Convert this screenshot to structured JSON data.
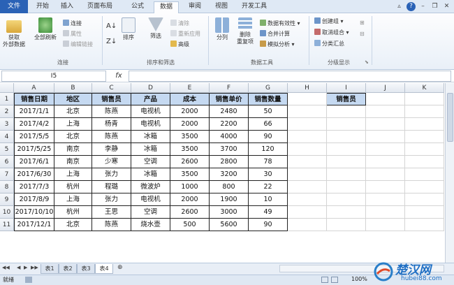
{
  "tabs": [
    "文件",
    "开始",
    "插入",
    "页面布局",
    "公式",
    "数据",
    "审阅",
    "视图",
    "开发工具"
  ],
  "active_tab": "数据",
  "ribbon": {
    "get_external": "获取\n外部数据",
    "refresh_all": "全部刷新",
    "connections": "连接",
    "properties": "属性",
    "edit_links": "编辑链接",
    "group_connections": "连接",
    "sort": "排序",
    "filter": "筛选",
    "clear": "清除",
    "reapply": "重新应用",
    "advanced": "高级",
    "group_sort_filter": "排序和筛选",
    "text_to_columns": "分列",
    "remove_duplicates": "删除\n重复项",
    "data_validation": "数据有效性",
    "consolidate": "合并计算",
    "what_if": "模拟分析",
    "group_data_tools": "数据工具",
    "group_btn": "创建组",
    "ungroup_btn": "取消组合",
    "subtotal": "分类汇总",
    "group_outline": "分级显示"
  },
  "formula_bar": {
    "name_box": "I5",
    "fx": "fx",
    "content": ""
  },
  "columns": [
    "A",
    "B",
    "C",
    "D",
    "E",
    "F",
    "G",
    "H",
    "I",
    "J",
    "K"
  ],
  "rows": [
    "1",
    "2",
    "3",
    "4",
    "5",
    "6",
    "7",
    "8",
    "9",
    "10",
    "11"
  ],
  "table_headers": [
    "销售日期",
    "地区",
    "销售员",
    "产品",
    "成本",
    "销售单价",
    "销售数量"
  ],
  "table_rows": [
    [
      "2017/1/1",
      "北京",
      "陈燕",
      "电视机",
      "2000",
      "2480",
      "50"
    ],
    [
      "2017/4/2",
      "上海",
      "杨青",
      "电视机",
      "2000",
      "2200",
      "66"
    ],
    [
      "2017/5/5",
      "北京",
      "陈燕",
      "冰箱",
      "3500",
      "4000",
      "90"
    ],
    [
      "2017/5/25",
      "南京",
      "李静",
      "冰箱",
      "3500",
      "3700",
      "120"
    ],
    [
      "2017/6/1",
      "南京",
      "少寒",
      "空调",
      "2600",
      "2800",
      "78"
    ],
    [
      "2017/6/30",
      "上海",
      "张力",
      "冰箱",
      "3500",
      "3200",
      "30"
    ],
    [
      "2017/7/3",
      "杭州",
      "程璐",
      "微波炉",
      "1000",
      "800",
      "22"
    ],
    [
      "2017/8/9",
      "上海",
      "张力",
      "电视机",
      "2000",
      "1900",
      "10"
    ],
    [
      "2017/10/10",
      "杭州",
      "王思",
      "空调",
      "2600",
      "3000",
      "49"
    ],
    [
      "2017/12/1",
      "北京",
      "陈燕",
      "烧水壶",
      "500",
      "5600",
      "90"
    ]
  ],
  "criteria_header": "销售员",
  "sheet_tabs": [
    "表1",
    "表2",
    "表3",
    "表4"
  ],
  "active_sheet": "表4",
  "status": {
    "ready": "就绪",
    "zoom": "100%"
  },
  "watermark": {
    "brand": "楚汉网",
    "url": "hubei88.com"
  },
  "colors": {
    "header_fill": "#c5d9f1",
    "file_tab": "#2a62b6"
  }
}
